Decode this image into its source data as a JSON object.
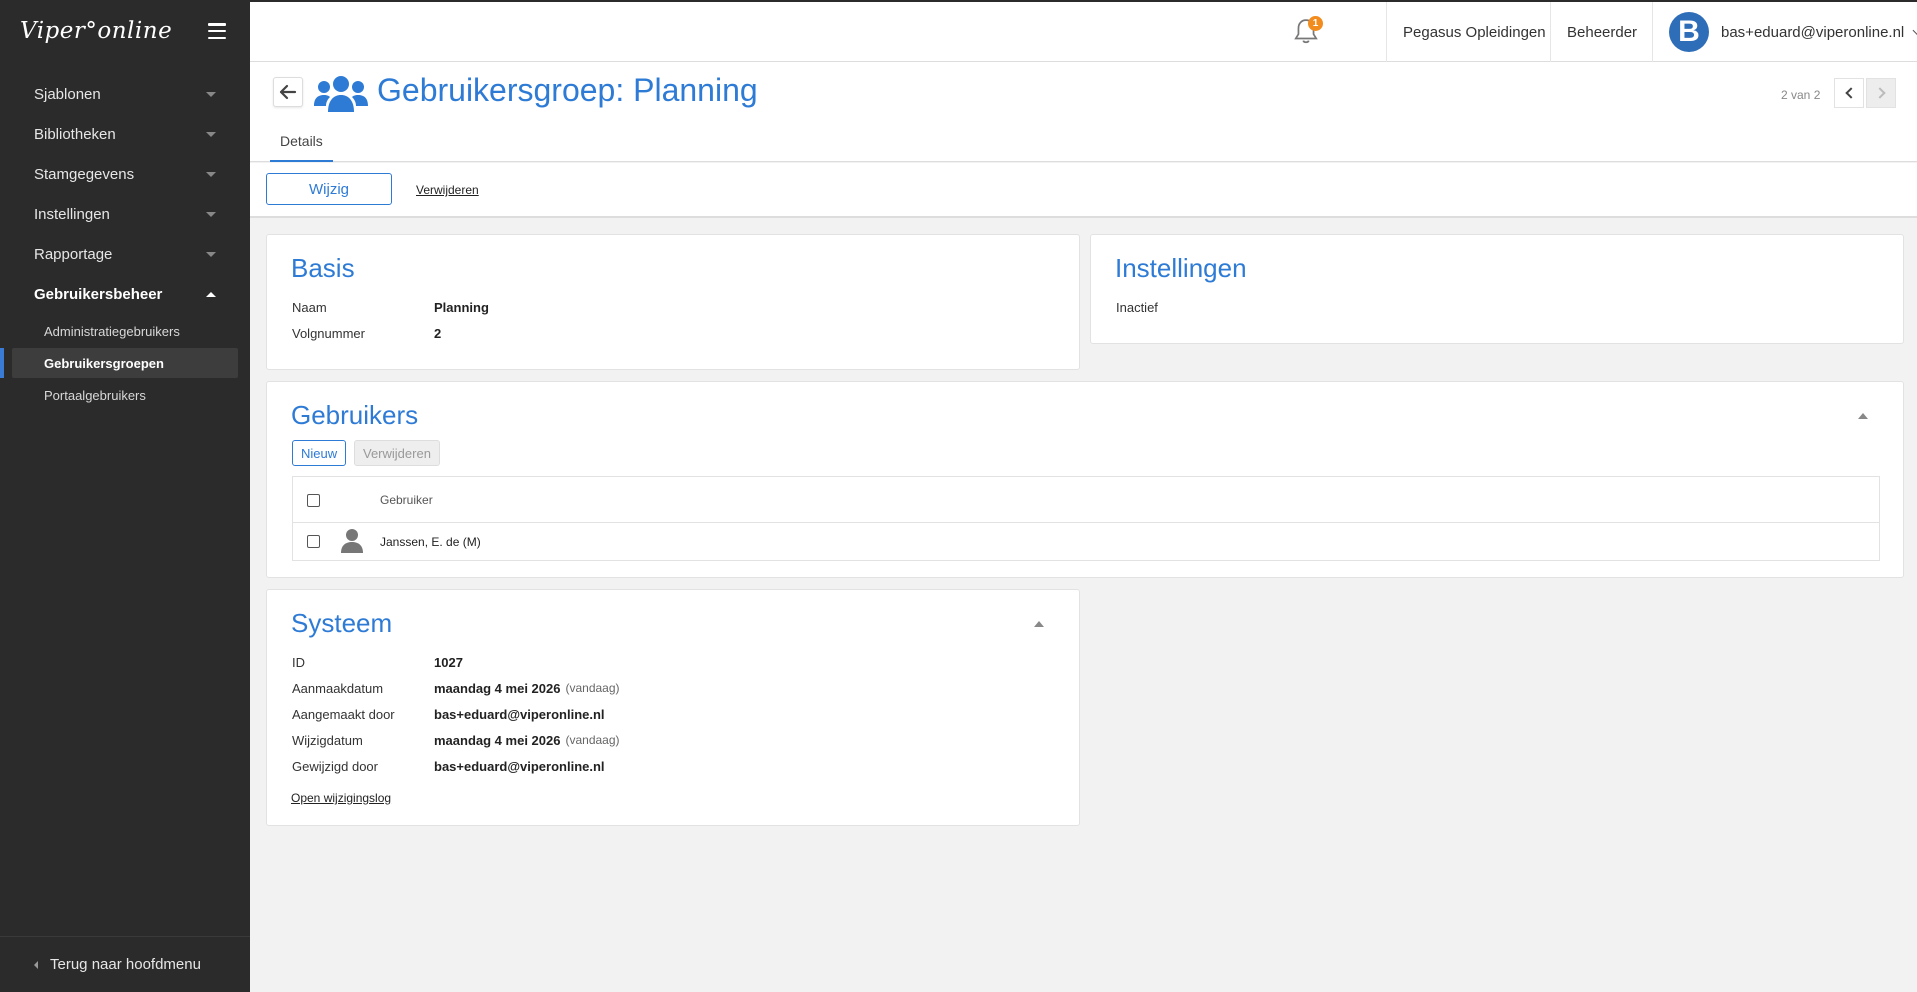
{
  "app": {
    "logo_text": "Viper°online"
  },
  "sidebar": {
    "items": [
      {
        "label": "Sjablonen"
      },
      {
        "label": "Bibliotheken"
      },
      {
        "label": "Stamgegevens"
      },
      {
        "label": "Instellingen"
      },
      {
        "label": "Rapportage"
      },
      {
        "label": "Gebruikersbeheer"
      }
    ],
    "subitems": [
      {
        "label": "Administratiegebruikers"
      },
      {
        "label": "Gebruikersgroepen"
      },
      {
        "label": "Portaalgebruikers"
      }
    ],
    "footer_label": "Terug naar hoofdmenu"
  },
  "topbar": {
    "notification_count": "1",
    "organization": "Pegasus Opleidingen",
    "role": "Beheerder",
    "avatar_letter": "B",
    "user_email": "bas+eduard@viperonline.nl"
  },
  "header": {
    "title": "Gebruikersgroep: Planning",
    "pager": "2 van 2",
    "tab": "Details"
  },
  "actions": {
    "edit": "Wijzig",
    "delete": "Verwijderen"
  },
  "basis": {
    "title": "Basis",
    "rows": [
      {
        "label": "Naam",
        "value": "Planning"
      },
      {
        "label": "Volgnummer",
        "value": "2"
      }
    ]
  },
  "instellingen": {
    "title": "Instellingen",
    "rows": [
      {
        "label": "Inactief",
        "value": ""
      }
    ]
  },
  "gebruikers": {
    "title": "Gebruikers",
    "new_button": "Nieuw",
    "delete_button": "Verwijderen",
    "column_header": "Gebruiker",
    "rows": [
      {
        "name": "Janssen, E. de (M)"
      }
    ]
  },
  "systeem": {
    "title": "Systeem",
    "rows": [
      {
        "label": "ID",
        "value": "1027",
        "note": ""
      },
      {
        "label": "Aanmaakdatum",
        "value": "maandag 4 mei 2026",
        "note": "(vandaag)"
      },
      {
        "label": "Aangemaakt door",
        "value": "bas+eduard@viperonline.nl",
        "note": ""
      },
      {
        "label": "Wijzigdatum",
        "value": "maandag 4 mei 2026",
        "note": "(vandaag)"
      },
      {
        "label": "Gewijzigd door",
        "value": "bas+eduard@viperonline.nl",
        "note": ""
      }
    ],
    "log_link": "Open wijzigingslog"
  },
  "colors": {
    "accent": "#2e7bd6",
    "sidebar_bg": "#2b2b2b",
    "badge": "#f28c1e"
  }
}
